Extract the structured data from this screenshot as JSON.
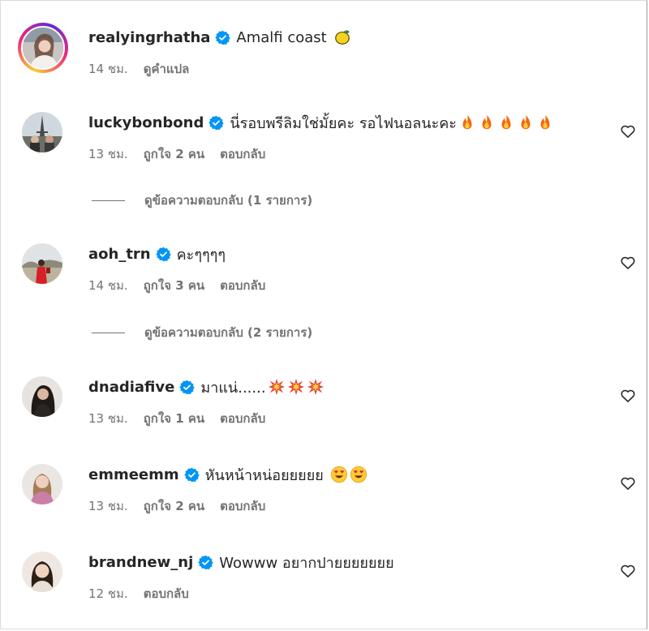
{
  "colors": {
    "text_primary": "#262626",
    "text_secondary": "#737373",
    "verified_badge": "#0095f6",
    "divider": "#dbdbdb"
  },
  "comments": [
    {
      "username": "realyingrhatha",
      "verified": true,
      "text": "Amalfi coast",
      "emojis": [
        "lemon-emoji"
      ],
      "time": "14 ชม.",
      "likes": "",
      "action": "ดูคำแปล",
      "has_like_button": false,
      "story_ring": true
    },
    {
      "username": "luckybonbond",
      "verified": true,
      "text": "นี่รอบพรีลิมใช่มั้ยคะ รอไฟนอลนะคะ",
      "emojis": [
        "fire-emoji",
        "fire-emoji",
        "fire-emoji",
        "fire-emoji",
        "fire-emoji"
      ],
      "time": "13 ชม.",
      "likes": "ถูกใจ 2 คน",
      "action": "ตอบกลับ",
      "has_like_button": true,
      "view_replies": "ดูข้อความตอบกลับ (1 รายการ)"
    },
    {
      "username": "aoh_trn",
      "verified": true,
      "text": "คะๆๆๆๆ",
      "emojis": [],
      "time": "14 ชม.",
      "likes": "ถูกใจ 3 คน",
      "action": "ตอบกลับ",
      "has_like_button": true,
      "view_replies": "ดูข้อความตอบกลับ (2 รายการ)"
    },
    {
      "username": "dnadiafive",
      "verified": true,
      "text": "มาแน่......",
      "emojis": [
        "collision-emoji",
        "collision-emoji",
        "collision-emoji"
      ],
      "time": "13 ชม.",
      "likes": "ถูกใจ 1 คน",
      "action": "ตอบกลับ",
      "has_like_button": true
    },
    {
      "username": "emmeemm",
      "verified": true,
      "text": "หันหน้าหน่อยยยยย",
      "emojis": [
        "heart-eyes-emoji",
        "heart-eyes-emoji"
      ],
      "time": "13 ชม.",
      "likes": "ถูกใจ 2 คน",
      "action": "ตอบกลับ",
      "has_like_button": true
    },
    {
      "username": "brandnew_nj",
      "verified": true,
      "text": "Wowww อยากปายยยยยยย",
      "emojis": [],
      "time": "12 ชม.",
      "likes": "",
      "action": "ตอบกลับ",
      "has_like_button": true
    }
  ]
}
